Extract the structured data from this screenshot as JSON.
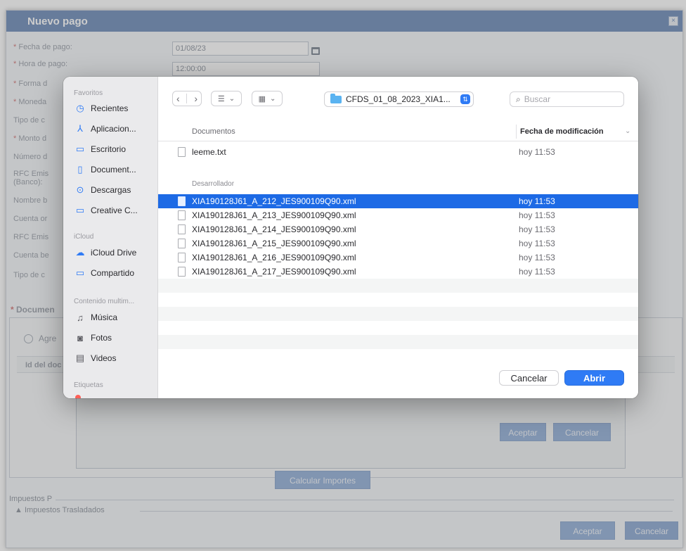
{
  "web": {
    "title": "Nuevo pago",
    "close_icon": "×",
    "fields": [
      {
        "label": "Fecha de pago:",
        "required": true
      },
      {
        "label": "Hora de pago:",
        "required": true
      },
      {
        "label": "Forma d",
        "required": true
      },
      {
        "label": "Moneda",
        "required": true
      },
      {
        "label": "Tipo de c",
        "required": false
      },
      {
        "label": "Monto d",
        "required": true
      },
      {
        "label": "Número d",
        "required": false
      },
      {
        "label": "RFC Emis",
        "required": false
      },
      {
        "label": "(Banco):",
        "required": false
      },
      {
        "label": "Nombre b",
        "required": false
      },
      {
        "label": "Cuenta or",
        "required": false
      },
      {
        "label": "RFC Emis",
        "required": false
      },
      {
        "label": "Cuenta be",
        "required": false
      },
      {
        "label": "Tipo de c",
        "required": false
      }
    ],
    "fecha_value": "01/08/23",
    "hora_value": "12:00:00",
    "documents_label": "Documen",
    "agregar_label": "Agre",
    "id_doc_label": "Id del doc",
    "inner_aceptar": "Aceptar",
    "inner_cancelar": "Cancelar",
    "calcular_importes": "Calcular Importes",
    "impuestos_label": "Impuestos P",
    "impuestos_trasladados": "Impuestos Trasladados",
    "footer_aceptar": "Aceptar",
    "footer_cancelar": "Cancelar"
  },
  "dialog": {
    "sidebar": {
      "favorites_label": "Favoritos",
      "favorites": [
        {
          "label": "Recientes",
          "icon": "clock-icon"
        },
        {
          "label": "Aplicacion...",
          "icon": "apps-icon"
        },
        {
          "label": "Escritorio",
          "icon": "desktop-icon"
        },
        {
          "label": "Document...",
          "icon": "document-icon"
        },
        {
          "label": "Descargas",
          "icon": "download-icon"
        },
        {
          "label": "Creative C...",
          "icon": "folder-icon"
        }
      ],
      "icloud_label": "iCloud",
      "icloud": [
        {
          "label": "iCloud Drive",
          "icon": "cloud-icon"
        },
        {
          "label": "Compartido",
          "icon": "shared-folder-icon"
        }
      ],
      "media_label": "Contenido multim...",
      "media": [
        {
          "label": "Música",
          "icon": "music-icon"
        },
        {
          "label": "Fotos",
          "icon": "camera-icon"
        },
        {
          "label": "Videos",
          "icon": "film-icon"
        }
      ],
      "tags_label": "Etiquetas"
    },
    "toolbar": {
      "back_icon": "‹",
      "forward_icon": "›",
      "list_view_icon": "☰",
      "grid_view_icon": "▦",
      "dropdown_icon": "⌄",
      "path": "CFDS_01_08_2023_XIA1...",
      "search_placeholder": "Buscar"
    },
    "columns": {
      "name": "Documentos",
      "date": "Fecha de modificación"
    },
    "groups": [
      {
        "label": "",
        "files": [
          {
            "name": "leeme.txt",
            "date": "hoy 11:53",
            "selected": false
          }
        ]
      },
      {
        "label": "Desarrollador",
        "files": [
          {
            "name": "XIA190128J61_A_212_JES900109Q90.xml",
            "date": "hoy 11:53",
            "selected": true
          },
          {
            "name": "XIA190128J61_A_213_JES900109Q90.xml",
            "date": "hoy 11:53",
            "selected": false
          },
          {
            "name": "XIA190128J61_A_214_JES900109Q90.xml",
            "date": "hoy 11:53",
            "selected": false
          },
          {
            "name": "XIA190128J61_A_215_JES900109Q90.xml",
            "date": "hoy 11:53",
            "selected": false
          },
          {
            "name": "XIA190128J61_A_216_JES900109Q90.xml",
            "date": "hoy 11:53",
            "selected": false
          },
          {
            "name": "XIA190128J61_A_217_JES900109Q90.xml",
            "date": "hoy 11:53",
            "selected": false
          }
        ]
      }
    ],
    "buttons": {
      "cancel": "Cancelar",
      "open": "Abrir"
    },
    "colors": {
      "accent": "#2f7bf5",
      "selection": "#1d6ae5",
      "folder": "#5ab3f1"
    }
  }
}
